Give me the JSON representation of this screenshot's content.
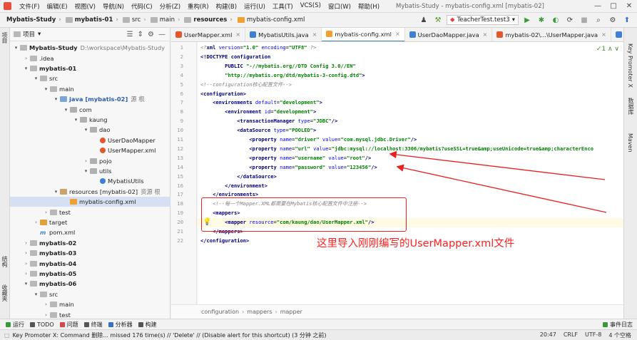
{
  "menu": {
    "items": [
      "文件(F)",
      "编辑(E)",
      "视图(V)",
      "导航(N)",
      "代码(C)",
      "分析(Z)",
      "重构(R)",
      "构建(B)",
      "运行(U)",
      "工具(T)",
      "VCS(S)",
      "窗口(W)",
      "帮助(H)"
    ],
    "window_title": "Mybatis-Study - mybatis-config.xml [mybatis-02]",
    "win_buttons": [
      "—",
      "□",
      "✕"
    ]
  },
  "breadcrumb": [
    "Mybatis-Study",
    "mybatis-01",
    "src",
    "main",
    "resources",
    "mybatis-config.xml"
  ],
  "run_config": "TeacherTest.test3",
  "project_panel": {
    "title": "项目"
  },
  "tree": [
    {
      "indent": 0,
      "arrow": "▾",
      "icon": "f",
      "label": "Mybatis-Study",
      "extra": "D:\\workspace\\Mybatis-Study",
      "bold": true
    },
    {
      "indent": 1,
      "arrow": "›",
      "icon": "f",
      "label": ".idea"
    },
    {
      "indent": 1,
      "arrow": "▾",
      "icon": "f",
      "label": "mybatis-01",
      "bold": true
    },
    {
      "indent": 2,
      "arrow": "▾",
      "icon": "f",
      "label": "src"
    },
    {
      "indent": 3,
      "arrow": "▾",
      "icon": "f",
      "label": "main"
    },
    {
      "indent": 4,
      "arrow": "▾",
      "icon": "src",
      "label": "java [mybatis-02]",
      "extra": "源 根",
      "bold": true
    },
    {
      "indent": 5,
      "arrow": "▾",
      "icon": "pkg",
      "label": "com"
    },
    {
      "indent": 6,
      "arrow": "▾",
      "icon": "pkg",
      "label": "kaung"
    },
    {
      "indent": 7,
      "arrow": "▾",
      "icon": "pkg",
      "label": "dao"
    },
    {
      "indent": 8,
      "arrow": "",
      "icon": "java",
      "label": "UserDaoMapper"
    },
    {
      "indent": 8,
      "arrow": "",
      "icon": "java",
      "label": "UserMapper.xml"
    },
    {
      "indent": 7,
      "arrow": "›",
      "icon": "pkg",
      "label": "pojo"
    },
    {
      "indent": 7,
      "arrow": "▾",
      "icon": "pkg",
      "label": "utils"
    },
    {
      "indent": 8,
      "arrow": "",
      "icon": "jv",
      "label": "MybatisUtils"
    },
    {
      "indent": 4,
      "arrow": "▾",
      "icon": "res",
      "label": "resources [mybatis-02]",
      "extra": "资源 根"
    },
    {
      "indent": 5,
      "arrow": "",
      "icon": "xml",
      "label": "mybatis-config.xml",
      "selected": true
    },
    {
      "indent": 3,
      "arrow": "›",
      "icon": "f",
      "label": "test"
    },
    {
      "indent": 2,
      "arrow": "›",
      "icon": "tgt",
      "label": "target"
    },
    {
      "indent": 2,
      "arrow": "",
      "icon": "pom",
      "label": "pom.xml"
    },
    {
      "indent": 1,
      "arrow": "›",
      "icon": "f",
      "label": "mybatis-02",
      "bold": true
    },
    {
      "indent": 1,
      "arrow": "›",
      "icon": "f",
      "label": "mybatis-03",
      "bold": true
    },
    {
      "indent": 1,
      "arrow": "›",
      "icon": "f",
      "label": "mybatis-04",
      "bold": true
    },
    {
      "indent": 1,
      "arrow": "›",
      "icon": "f",
      "label": "mybatis-05",
      "bold": true
    },
    {
      "indent": 1,
      "arrow": "▾",
      "icon": "f",
      "label": "mybatis-06",
      "bold": true
    },
    {
      "indent": 2,
      "arrow": "▾",
      "icon": "f",
      "label": "src"
    },
    {
      "indent": 3,
      "arrow": "›",
      "icon": "f",
      "label": "main"
    },
    {
      "indent": 3,
      "arrow": "›",
      "icon": "f",
      "label": "test"
    }
  ],
  "tabs": [
    {
      "label": "UserMapper.xml",
      "icon_color": "#e4572e",
      "active": false
    },
    {
      "label": "MybatisUtils.java",
      "icon_color": "#3f7fd4",
      "active": false
    },
    {
      "label": "mybatis-config.xml",
      "icon_color": "#f0a030",
      "active": true
    },
    {
      "label": "UserDaoMapper.java",
      "icon_color": "#3f7fd4",
      "active": false
    },
    {
      "label": "mybatis-02\\...\\UserMapper.java",
      "icon_color": "#e4572e",
      "active": false
    },
    {
      "label": "pom.xm",
      "icon_color": "#3f7fd4",
      "active": false
    }
  ],
  "left_stripe": [
    "项目",
    "结构",
    "收藏夹"
  ],
  "right_stripe": [
    "Key Promoter X",
    "数据库",
    "Maven"
  ],
  "code": [
    [
      [
        "c-com",
        "<?"
      ],
      [
        "c-tag",
        "xml "
      ],
      [
        "c-attr",
        "version"
      ],
      [
        "",
        "="
      ],
      [
        "c-str",
        "\"1.0\" "
      ],
      [
        "c-attr",
        "encoding"
      ],
      [
        "",
        "="
      ],
      [
        "c-str",
        "\"UTF8\" "
      ],
      [
        "c-com",
        "?>"
      ]
    ],
    [
      [
        "c-doc",
        "<!DOCTYPE "
      ],
      [
        "c-kw",
        "configuration"
      ]
    ],
    [
      [
        "",
        "        "
      ],
      [
        "c-kw",
        "PUBLIC "
      ],
      [
        "c-str",
        "\"-//mybatis.org//DTD Config 3.0//EN\""
      ]
    ],
    [
      [
        "",
        "        "
      ],
      [
        "c-str",
        "\"http://mybatis.org/dtd/mybatis-3-config.dtd\""
      ],
      [
        "c-doc",
        ">"
      ]
    ],
    [
      [
        "c-com",
        "<!--configuration核心配置文件-->"
      ]
    ],
    [
      [
        "c-tag",
        "<configuration>"
      ]
    ],
    [
      [
        "",
        "    "
      ],
      [
        "c-tag",
        "<environments "
      ],
      [
        "c-attr",
        "default"
      ],
      [
        "",
        "="
      ],
      [
        "c-str",
        "\"development\""
      ],
      [
        "c-tag",
        ">"
      ]
    ],
    [
      [
        "",
        "        "
      ],
      [
        "c-tag",
        "<environment "
      ],
      [
        "c-attr",
        "id"
      ],
      [
        "",
        "="
      ],
      [
        "c-str",
        "\"development\""
      ],
      [
        "c-tag",
        ">"
      ]
    ],
    [
      [
        "",
        "            "
      ],
      [
        "c-tag",
        "<transactionManager "
      ],
      [
        "c-attr",
        "type"
      ],
      [
        "",
        "="
      ],
      [
        "c-str",
        "\"JDBC\""
      ],
      [
        "c-tag",
        "/>"
      ]
    ],
    [
      [
        "",
        "            "
      ],
      [
        "c-tag",
        "<dataSource "
      ],
      [
        "c-attr",
        "type"
      ],
      [
        "",
        "="
      ],
      [
        "c-str",
        "\"POOLED\""
      ],
      [
        "c-tag",
        ">"
      ]
    ],
    [
      [
        "",
        "                "
      ],
      [
        "c-tag",
        "<property "
      ],
      [
        "c-attr",
        "name"
      ],
      [
        "",
        "="
      ],
      [
        "c-str",
        "\"driver\" "
      ],
      [
        "c-attr",
        "value"
      ],
      [
        "",
        "="
      ],
      [
        "c-str",
        "\"com.mysql.jdbc.Driver\""
      ],
      [
        "c-tag",
        "/>"
      ]
    ],
    [
      [
        "",
        "                "
      ],
      [
        "c-tag",
        "<property "
      ],
      [
        "c-attr",
        "name"
      ],
      [
        "",
        "="
      ],
      [
        "c-str",
        "\"url\" "
      ],
      [
        "c-attr",
        "value"
      ],
      [
        "",
        "="
      ],
      [
        "c-str",
        "\"jdbc:mysql://localhost:3306/mybatis?useSSL=true&amp;useUnicode=true&amp;characterEnco"
      ]
    ],
    [
      [
        "",
        "                "
      ],
      [
        "c-tag",
        "<property "
      ],
      [
        "c-attr",
        "name"
      ],
      [
        "",
        "="
      ],
      [
        "c-str",
        "\"username\" "
      ],
      [
        "c-attr",
        "value"
      ],
      [
        "",
        "="
      ],
      [
        "c-str",
        "\"root\""
      ],
      [
        "c-tag",
        "/>"
      ]
    ],
    [
      [
        "",
        "                "
      ],
      [
        "c-tag",
        "<property "
      ],
      [
        "c-attr",
        "name"
      ],
      [
        "",
        "="
      ],
      [
        "c-str",
        "\"password\" "
      ],
      [
        "c-attr",
        "value"
      ],
      [
        "",
        "="
      ],
      [
        "c-str",
        "\"123456\""
      ],
      [
        "c-tag",
        "/>"
      ]
    ],
    [
      [
        "",
        "            "
      ],
      [
        "c-tag",
        "</dataSource>"
      ]
    ],
    [
      [
        "",
        "        "
      ],
      [
        "c-tag",
        "</environment>"
      ]
    ],
    [
      [
        "",
        "    "
      ],
      [
        "c-tag",
        "</environments>"
      ]
    ],
    [
      [
        "",
        "    "
      ],
      [
        "c-com",
        "<!--每一个Mapper.XML都需要在Mybatis核心配置文件中注册-->"
      ]
    ],
    [
      [
        "",
        "    "
      ],
      [
        "c-tag",
        "<mappers>"
      ]
    ],
    [
      [
        "",
        "        "
      ],
      [
        "c-tag",
        "<mapper "
      ],
      [
        "c-attr",
        "resource"
      ],
      [
        "",
        "="
      ],
      [
        "c-str",
        "\"com/kaung/dao/UserMapper.xml\""
      ],
      [
        "c-tag",
        "/>"
      ]
    ],
    [
      [
        "",
        "    "
      ],
      [
        "c-tag",
        "</mappers>"
      ]
    ],
    [
      [
        "c-tag",
        "</configuration>"
      ]
    ]
  ],
  "annotation": "这里导入刚刚编写的UserMapper.xml文件",
  "editor_breadcrumb": [
    "configuration",
    "mappers",
    "mapper"
  ],
  "tool_windows": [
    "运行",
    "TODO",
    "问题",
    "终端",
    "分析器",
    "构建"
  ],
  "event_log": "事件日志",
  "status": {
    "message": "Key Promoter X: Command 删除... missed 176 time(s) // 'Delete' // (Disable alert for this shortcut) (3 分钟 之前)",
    "position": "20:47",
    "line_sep": "CRLF",
    "encoding": "UTF-8",
    "indent": "4 个空格"
  },
  "colors": {
    "accent": "#4a88c7",
    "annotation": "#ff2020",
    "selection": "#d5e1f2"
  }
}
